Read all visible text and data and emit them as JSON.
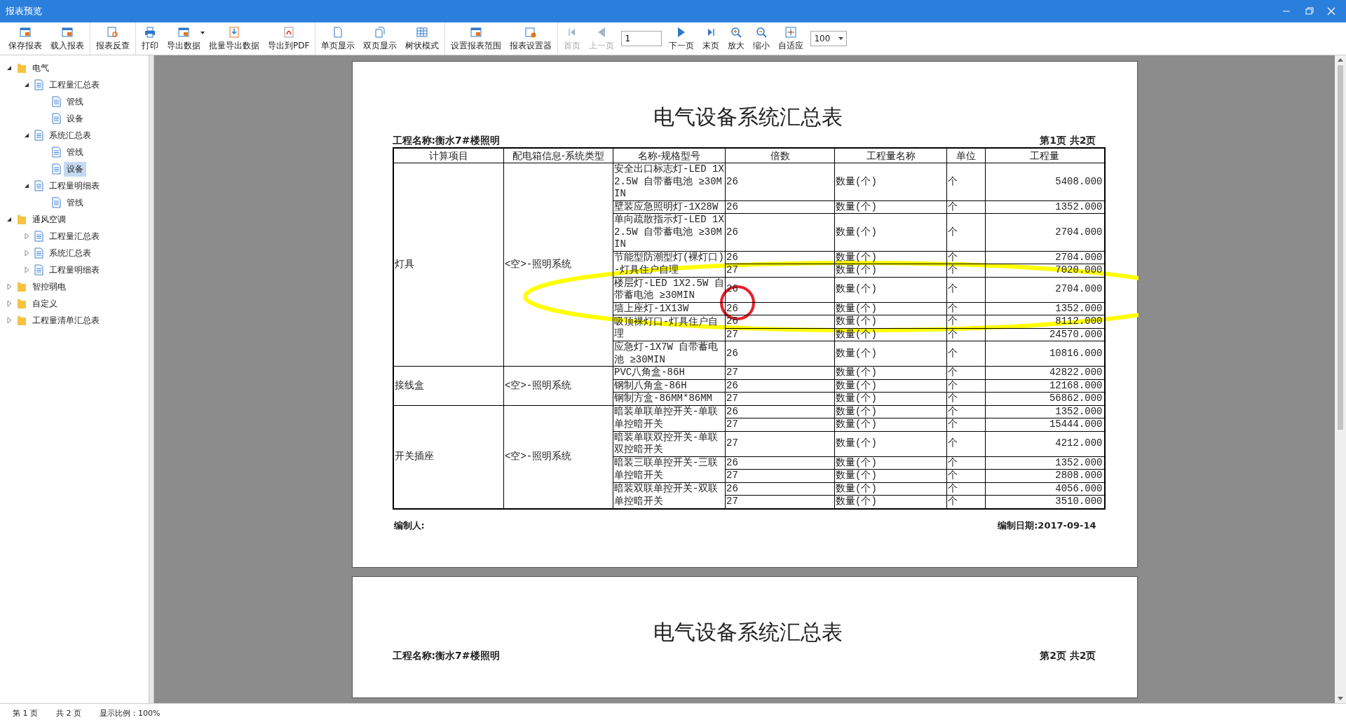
{
  "window": {
    "title": "报表预览"
  },
  "toolbar": {
    "groups": [
      [
        {
          "kind": "button",
          "label": "保存报表",
          "disabled": false
        },
        {
          "kind": "button",
          "label": "载入报表",
          "disabled": false
        }
      ],
      [
        {
          "kind": "button",
          "label": "报表反查",
          "disabled": false
        }
      ],
      [
        {
          "kind": "button",
          "label": "打印",
          "disabled": false
        },
        {
          "kind": "dropdown",
          "label": "导出数据",
          "disabled": false
        },
        {
          "kind": "button",
          "label": "批量导出数据",
          "disabled": false
        },
        {
          "kind": "button",
          "label": "导出到PDF",
          "disabled": false
        }
      ],
      [
        {
          "kind": "button",
          "label": "单页显示",
          "disabled": false
        },
        {
          "kind": "button",
          "label": "双页显示",
          "disabled": false
        },
        {
          "kind": "button",
          "label": "树状模式",
          "disabled": false
        }
      ],
      [
        {
          "kind": "button",
          "label": "设置报表范围",
          "disabled": false
        },
        {
          "kind": "button",
          "label": "报表设置器",
          "disabled": false
        }
      ],
      [
        {
          "kind": "button",
          "label": "首页",
          "disabled": true
        },
        {
          "kind": "button",
          "label": "上一页",
          "disabled": true
        },
        {
          "kind": "input",
          "value": "1"
        },
        {
          "kind": "button",
          "label": "下一页",
          "disabled": false
        },
        {
          "kind": "button",
          "label": "末页",
          "disabled": false
        },
        {
          "kind": "button",
          "label": "放大",
          "disabled": false
        },
        {
          "kind": "button",
          "label": "缩小",
          "disabled": false
        },
        {
          "kind": "button",
          "label": "自适应",
          "disabled": false
        },
        {
          "kind": "select",
          "value": "100"
        }
      ]
    ]
  },
  "tree": [
    {
      "kind": "folder",
      "label": "电气",
      "expanded": true,
      "selected": false,
      "children": [
        {
          "kind": "doc",
          "label": "工程量汇总表",
          "expanded": true,
          "selected": false,
          "children": [
            {
              "kind": "doc",
              "label": "管线",
              "selected": false
            },
            {
              "kind": "doc",
              "label": "设备",
              "selected": false
            }
          ]
        },
        {
          "kind": "doc",
          "label": "系统汇总表",
          "expanded": true,
          "selected": false,
          "children": [
            {
              "kind": "doc",
              "label": "管线",
              "selected": false
            },
            {
              "kind": "doc",
              "label": "设备",
              "selected": true
            }
          ]
        },
        {
          "kind": "doc",
          "label": "工程量明细表",
          "expanded": true,
          "selected": false,
          "children": [
            {
              "kind": "doc",
              "label": "管线",
              "selected": false
            }
          ]
        }
      ]
    },
    {
      "kind": "folder",
      "label": "通风空调",
      "expanded": true,
      "selected": false,
      "children": [
        {
          "kind": "doc",
          "label": "工程量汇总表",
          "expanded": false,
          "selected": false
        },
        {
          "kind": "doc",
          "label": "系统汇总表",
          "expanded": false,
          "selected": false
        },
        {
          "kind": "doc",
          "label": "工程量明细表",
          "expanded": false,
          "selected": false
        }
      ]
    },
    {
      "kind": "folder",
      "label": "智控弱电",
      "expanded": false,
      "selected": false
    },
    {
      "kind": "folder",
      "label": "自定义",
      "expanded": false,
      "selected": false
    },
    {
      "kind": "folder",
      "label": "工程量清单汇总表",
      "expanded": false,
      "selected": false
    }
  ],
  "pages": [
    {
      "title": "电气设备系统汇总表",
      "project": "工程名称:衡水7#楼照明",
      "page_info": "第1页 共2页",
      "columns": [
        "计算项目",
        "配电箱信息-系统类型",
        "名称-规格型号",
        "倍数",
        "工程量名称",
        "单位",
        "工程量"
      ],
      "groups": [
        {
          "item": "灯具",
          "box": "<空>-照明系统",
          "entries": [
            {
              "name": "安全出口标志灯-LED 1X2.5W 自带蓄电池 ≥30MIN",
              "rows": [
                {
                  "multiplier": "26",
                  "qty_name": "数量(个)",
                  "unit": "个",
                  "quantity": "5408.000"
                }
              ]
            },
            {
              "name": "壁装应急照明灯-1X28W",
              "rows": [
                {
                  "multiplier": "26",
                  "qty_name": "数量(个)",
                  "unit": "个",
                  "quantity": "1352.000"
                }
              ]
            },
            {
              "name": "单向疏散指示灯-LED 1X2.5W 自带蓄电池 ≥30MIN",
              "rows": [
                {
                  "multiplier": "26",
                  "qty_name": "数量(个)",
                  "unit": "个",
                  "quantity": "2704.000"
                }
              ]
            },
            {
              "name": "节能型防潮型灯(裸灯口)-灯具住户自理",
              "rows": [
                {
                  "multiplier": "26",
                  "qty_name": "数量(个)",
                  "unit": "个",
                  "quantity": "2704.000"
                },
                {
                  "multiplier": "27",
                  "qty_name": "数量(个)",
                  "unit": "个",
                  "quantity": "7020.000"
                }
              ]
            },
            {
              "name": "楼层灯-LED 1X2.5W 自带蓄电池 ≥30MIN",
              "rows": [
                {
                  "multiplier": "26",
                  "qty_name": "数量(个)",
                  "unit": "个",
                  "quantity": "2704.000"
                }
              ]
            },
            {
              "name": "墙上座灯-1X13W",
              "rows": [
                {
                  "multiplier": "26",
                  "qty_name": "数量(个)",
                  "unit": "个",
                  "quantity": "1352.000"
                }
              ]
            },
            {
              "name": "吸顶裸灯口-灯具住户自理",
              "rows": [
                {
                  "multiplier": "26",
                  "qty_name": "数量(个)",
                  "unit": "个",
                  "quantity": "8112.000"
                },
                {
                  "multiplier": "27",
                  "qty_name": "数量(个)",
                  "unit": "个",
                  "quantity": "24570.000"
                }
              ]
            },
            {
              "name": "应急灯-1X7W 自带蓄电池 ≥30MIN",
              "rows": [
                {
                  "multiplier": "26",
                  "qty_name": "数量(个)",
                  "unit": "个",
                  "quantity": "10816.000"
                }
              ]
            }
          ]
        },
        {
          "item": "接线盒",
          "box": "<空>-照明系统",
          "entries": [
            {
              "name": "PVC八角盒-86H",
              "rows": [
                {
                  "multiplier": "27",
                  "qty_name": "数量(个)",
                  "unit": "个",
                  "quantity": "42822.000"
                }
              ]
            },
            {
              "name": "钢制八角盒-86H",
              "rows": [
                {
                  "multiplier": "26",
                  "qty_name": "数量(个)",
                  "unit": "个",
                  "quantity": "12168.000"
                }
              ]
            },
            {
              "name": "钢制方盒-86MM*86MM",
              "rows": [
                {
                  "multiplier": "27",
                  "qty_name": "数量(个)",
                  "unit": "个",
                  "quantity": "56862.000"
                }
              ]
            }
          ]
        },
        {
          "item": "开关插座",
          "box": "<空>-照明系统",
          "entries": [
            {
              "name": "暗装单联单控开关-单联单控暗开关",
              "rows": [
                {
                  "multiplier": "26",
                  "qty_name": "数量(个)",
                  "unit": "个",
                  "quantity": "1352.000"
                },
                {
                  "multiplier": "27",
                  "qty_name": "数量(个)",
                  "unit": "个",
                  "quantity": "15444.000"
                }
              ]
            },
            {
              "name": "暗装单联双控开关-单联双控暗开关",
              "rows": [
                {
                  "multiplier": "27",
                  "qty_name": "数量(个)",
                  "unit": "个",
                  "quantity": "4212.000"
                }
              ]
            },
            {
              "name": "暗装三联单控开关-三联单控暗开关",
              "rows": [
                {
                  "multiplier": "26",
                  "qty_name": "数量(个)",
                  "unit": "个",
                  "quantity": "1352.000"
                },
                {
                  "multiplier": "27",
                  "qty_name": "数量(个)",
                  "unit": "个",
                  "quantity": "2808.000"
                }
              ]
            },
            {
              "name": "暗装双联单控开关-双联单控暗开关",
              "rows": [
                {
                  "multiplier": "26",
                  "qty_name": "数量(个)",
                  "unit": "个",
                  "quantity": "4056.000"
                },
                {
                  "multiplier": "27",
                  "qty_name": "数量(个)",
                  "unit": "个",
                  "quantity": "3510.000"
                }
              ]
            }
          ]
        }
      ],
      "preparer": "编制人:",
      "date": "编制日期:2017-09-14"
    },
    {
      "title": "电气设备系统汇总表",
      "project": "工程名称:衡水7#楼照明",
      "page_info": "第2页 共2页"
    }
  ],
  "annotations": [
    {
      "kind": "ellipse",
      "color": "#ffff00"
    },
    {
      "kind": "circle",
      "color": "#e8202a"
    }
  ],
  "status_bar": {
    "page": "第 1 页",
    "total": "共 2 页",
    "zoom": "显示比例：100%"
  }
}
